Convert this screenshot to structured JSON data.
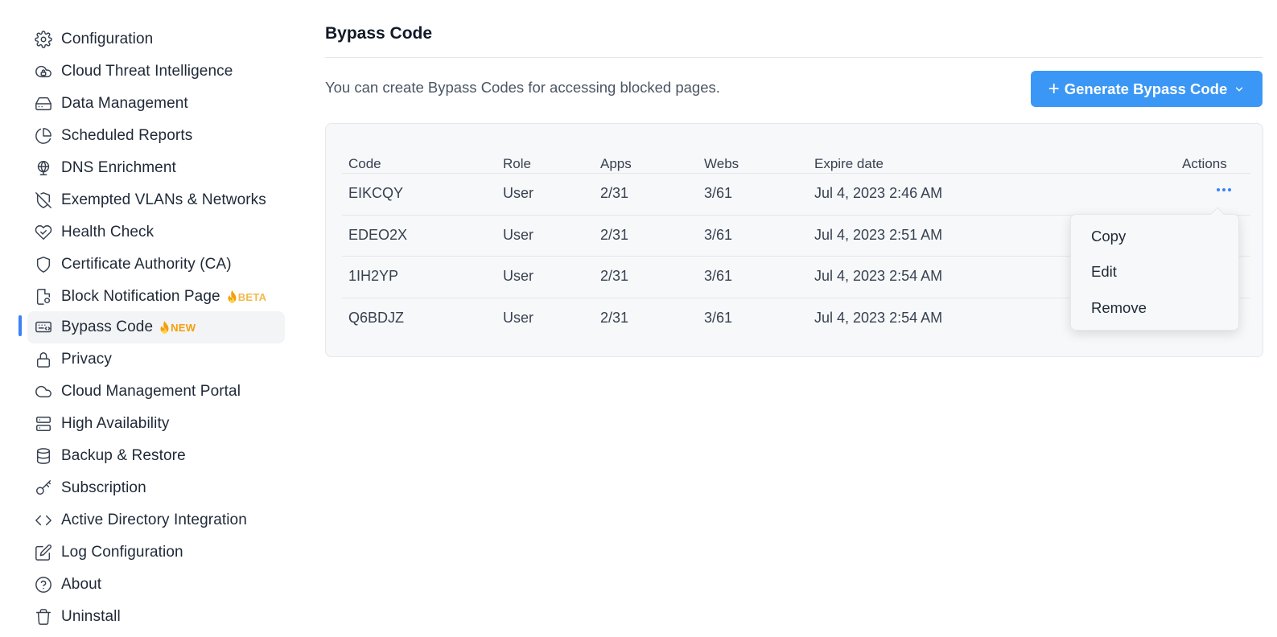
{
  "sidebar": {
    "items": [
      {
        "label": "Configuration",
        "icon": "gear-icon"
      },
      {
        "label": "Cloud Threat Intelligence",
        "icon": "cloud-lock-icon"
      },
      {
        "label": "Data Management",
        "icon": "drive-icon"
      },
      {
        "label": "Scheduled Reports",
        "icon": "pie-chart-icon"
      },
      {
        "label": "DNS Enrichment",
        "icon": "globe-icon"
      },
      {
        "label": "Exempted VLANs & Networks",
        "icon": "shield-off-icon"
      },
      {
        "label": "Health Check",
        "icon": "heart-check-icon"
      },
      {
        "label": "Certificate Authority (CA)",
        "icon": "shield-icon"
      },
      {
        "label": "Block Notification Page",
        "icon": "file-gear-icon",
        "badge": "BETA"
      },
      {
        "label": "Bypass Code",
        "icon": "keyboard-code-icon",
        "badge": "NEW",
        "active": true
      },
      {
        "label": "Privacy",
        "icon": "lock-icon"
      },
      {
        "label": "Cloud Management Portal",
        "icon": "cloud-icon"
      },
      {
        "label": "High Availability",
        "icon": "server-icon"
      },
      {
        "label": "Backup & Restore",
        "icon": "database-icon"
      },
      {
        "label": "Subscription",
        "icon": "key-icon"
      },
      {
        "label": "Active Directory Integration",
        "icon": "code-icon"
      },
      {
        "label": "Log Configuration",
        "icon": "edit-icon"
      },
      {
        "label": "About",
        "icon": "help-circle-icon"
      },
      {
        "label": "Uninstall",
        "icon": "trash-icon"
      }
    ]
  },
  "main": {
    "title": "Bypass Code",
    "description": "You can create Bypass Codes for accessing blocked pages.",
    "generate_button": "Generate Bypass Code",
    "table": {
      "headers": {
        "code": "Code",
        "role": "Role",
        "apps": "Apps",
        "webs": "Webs",
        "expire": "Expire date",
        "actions": "Actions"
      },
      "rows": [
        {
          "code": "EIKCQY",
          "role": "User",
          "apps": "2/31",
          "webs": "3/61",
          "expire": "Jul 4, 2023 2:46 AM"
        },
        {
          "code": "EDEO2X",
          "role": "User",
          "apps": "2/31",
          "webs": "3/61",
          "expire": "Jul 4, 2023 2:51 AM"
        },
        {
          "code": "1IH2YP",
          "role": "User",
          "apps": "2/31",
          "webs": "3/61",
          "expire": "Jul 4, 2023 2:54 AM"
        },
        {
          "code": "Q6BDJZ",
          "role": "User",
          "apps": "2/31",
          "webs": "3/61",
          "expire": "Jul 4, 2023 2:54 AM"
        }
      ]
    },
    "actions_menu": {
      "items": [
        "Copy",
        "Edit",
        "Remove"
      ]
    }
  },
  "colors": {
    "accent": "#3b97f5",
    "badge": "#f59e0b",
    "active_indicator": "#3b82f6"
  }
}
